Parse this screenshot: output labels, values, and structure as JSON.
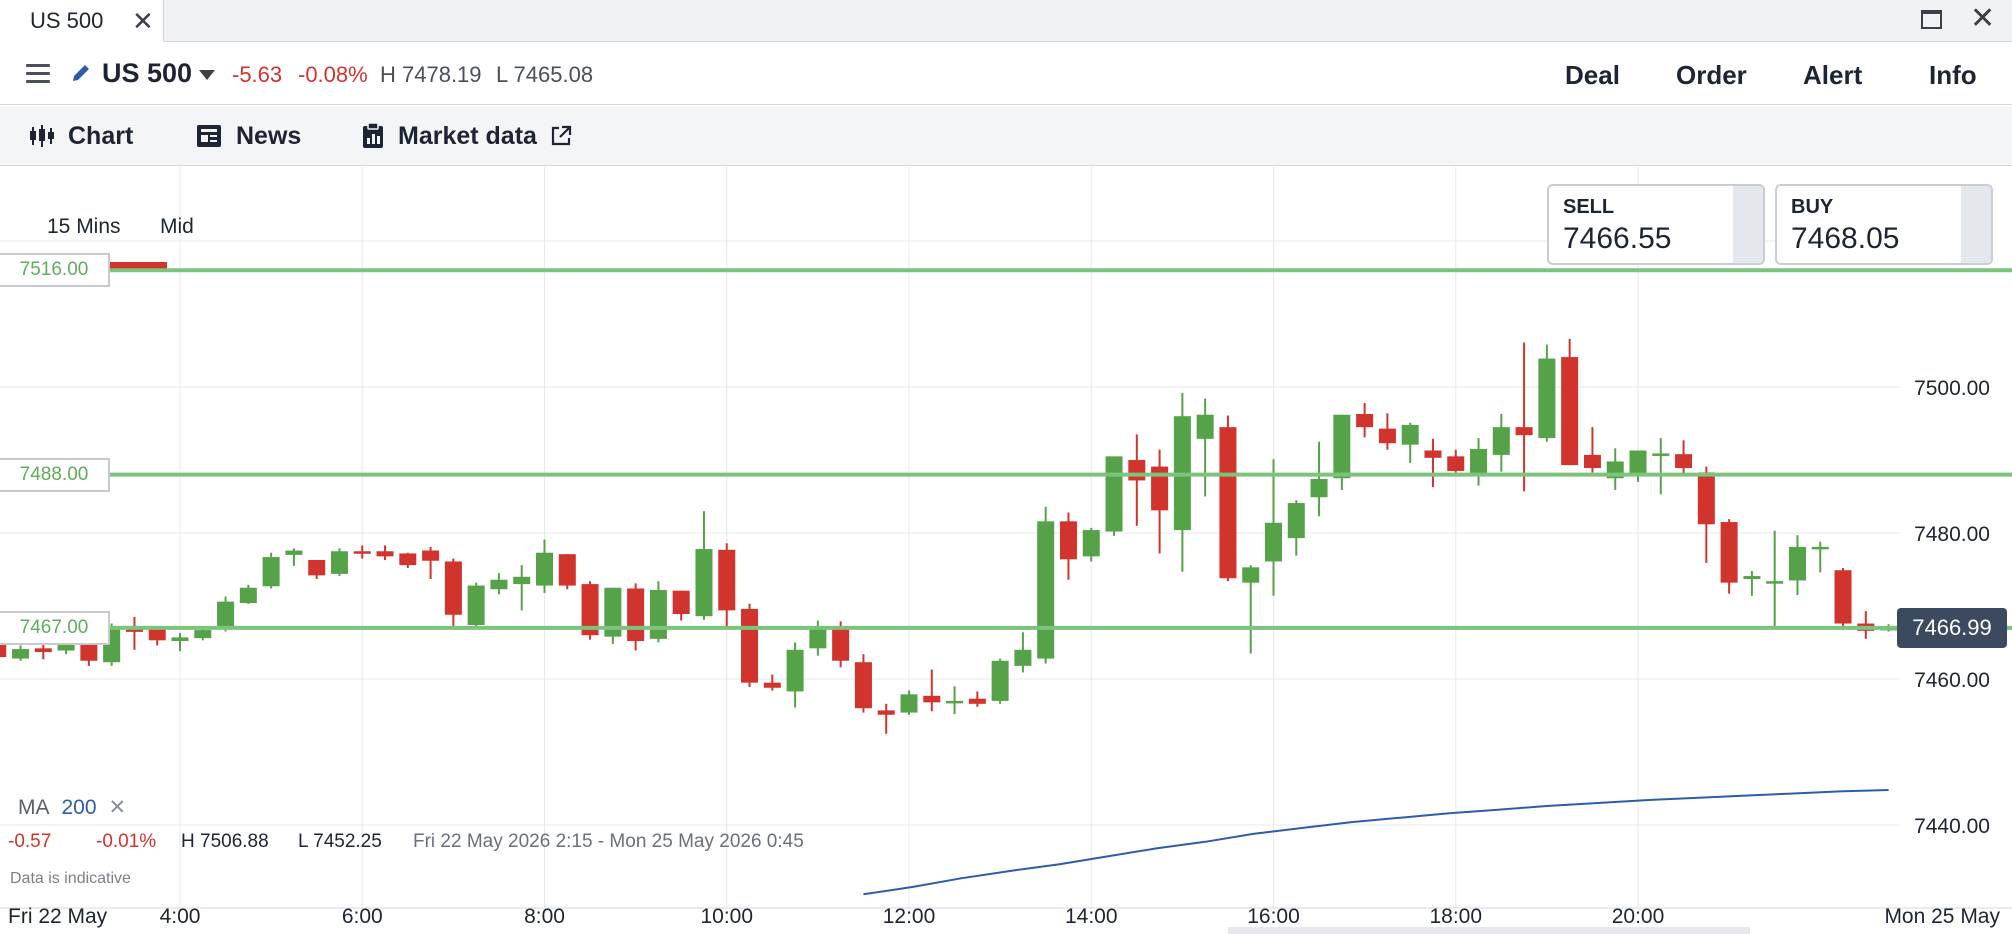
{
  "window": {
    "tab_title": "US 500"
  },
  "header": {
    "instrument": "US 500",
    "change": "-5.63",
    "change_pct": "-0.08%",
    "high": "H 7478.19",
    "low": "L 7465.08",
    "actions": [
      "Deal",
      "Order",
      "Alert",
      "Info"
    ]
  },
  "tabs": [
    {
      "label": "Chart",
      "active": true,
      "icon": "candlestick-icon"
    },
    {
      "label": "News",
      "icon": "newspaper-icon"
    },
    {
      "label": "Market data",
      "icon": "clipboard-icon",
      "external": true
    }
  ],
  "chart_toolbar": {
    "timeframe": "15 Mins",
    "price_type": "Mid"
  },
  "quotes": {
    "sell_label": "SELL",
    "sell": "7466.55",
    "buy_label": "BUY",
    "buy": "7468.05"
  },
  "levels": [
    {
      "label": "7516.00",
      "value": 7516.0
    },
    {
      "label": "7488.00",
      "value": 7488.0
    },
    {
      "label": "7467.00",
      "value": 7467.0
    }
  ],
  "current_price": "7466.99",
  "indicator": {
    "label": "MA",
    "period": "200"
  },
  "stats": {
    "change": "-0.57",
    "change_pct": "-0.01%",
    "high": "H 7506.88",
    "low": "L 7452.25",
    "range": "Fri 22 May 2026 2:15 - Mon 25 May 2026 0:45"
  },
  "disclaimer": "Data is indicative",
  "colors": {
    "up": "#55a249",
    "down": "#d0342c",
    "level": "#7cc47c",
    "ma": "#2d5da7",
    "accent": "#d0342c"
  },
  "chart_data": {
    "type": "candlestick",
    "x_axis": {
      "start_label": "Fri 22 May",
      "end_label": "Mon 25 May",
      "ticks": [
        "4:00",
        "6:00",
        "8:00",
        "10:00",
        "12:00",
        "14:00",
        "16:00",
        "18:00",
        "20:00"
      ]
    },
    "y_axis": {
      "ticks": [
        7500,
        7480,
        7460,
        7440
      ],
      "tick_labels": [
        "7500.00",
        "7480.00",
        "7460.00",
        "7440.00"
      ],
      "grid": true
    },
    "interval": "15 Mins",
    "candles": [
      [
        7465.8,
        7466.8,
        7464.8,
        7465.3
      ],
      [
        7465.5,
        7466.5,
        7457.5,
        7463.0
      ],
      [
        7462.8,
        7464.6,
        7462.5,
        7464.1
      ],
      [
        7464.2,
        7464.9,
        7462.7,
        7463.7
      ],
      [
        7463.9,
        7466.3,
        7463.4,
        7465.4
      ],
      [
        7465.7,
        7466.8,
        7461.8,
        7462.5
      ],
      [
        7462.3,
        7467.6,
        7461.8,
        7467.0
      ],
      [
        7466.8,
        7468.5,
        7464.0,
        7466.5
      ],
      [
        7466.8,
        7467.2,
        7464.6,
        7465.3
      ],
      [
        7465.2,
        7466.3,
        7463.8,
        7465.7
      ],
      [
        7465.6,
        7467.2,
        7465.3,
        7466.7
      ],
      [
        7466.9,
        7471.3,
        7466.5,
        7470.6
      ],
      [
        7470.4,
        7472.9,
        7470.3,
        7472.5
      ],
      [
        7472.7,
        7477.3,
        7472.4,
        7476.7
      ],
      [
        7477.0,
        7477.9,
        7475.5,
        7477.6
      ],
      [
        7476.3,
        7476.3,
        7473.7,
        7474.2
      ],
      [
        7474.4,
        7477.9,
        7474.1,
        7477.5
      ],
      [
        7477.5,
        7478.3,
        7476.5,
        7477.3
      ],
      [
        7477.5,
        7478.3,
        7476.3,
        7476.8
      ],
      [
        7477.2,
        7477.3,
        7475.2,
        7475.6
      ],
      [
        7477.6,
        7478.1,
        7473.7,
        7476.2
      ],
      [
        7476.1,
        7476.5,
        7467.0,
        7468.8
      ],
      [
        7467.4,
        7473.2,
        7467.1,
        7472.8
      ],
      [
        7472.3,
        7474.5,
        7471.6,
        7473.6
      ],
      [
        7473.0,
        7475.6,
        7469.4,
        7474.0
      ],
      [
        7472.8,
        7479.1,
        7471.8,
        7477.3
      ],
      [
        7477.1,
        7477.1,
        7472.3,
        7472.8
      ],
      [
        7473.0,
        7473.4,
        7465.4,
        7466.0
      ],
      [
        7465.8,
        7467.7,
        7464.8,
        7472.5
      ],
      [
        7472.4,
        7473.1,
        7463.9,
        7465.2
      ],
      [
        7465.5,
        7473.4,
        7465.0,
        7472.2
      ],
      [
        7472.1,
        7472.1,
        7468.0,
        7468.9
      ],
      [
        7468.6,
        7483.0,
        7468.1,
        7477.8
      ],
      [
        7477.7,
        7478.6,
        7467.2,
        7469.4
      ],
      [
        7469.6,
        7470.3,
        7458.9,
        7459.5
      ],
      [
        7459.5,
        7460.6,
        7458.4,
        7458.8
      ],
      [
        7458.3,
        7465.0,
        7456.1,
        7464.0
      ],
      [
        7464.2,
        7468.0,
        7463.2,
        7467.0
      ],
      [
        7467.2,
        7467.9,
        7461.6,
        7462.5
      ],
      [
        7462.3,
        7463.4,
        7455.4,
        7456.0
      ],
      [
        7455.7,
        7456.6,
        7452.5,
        7455.1
      ],
      [
        7455.4,
        7458.4,
        7455.1,
        7457.9
      ],
      [
        7457.7,
        7461.3,
        7455.6,
        7456.8
      ],
      [
        7456.7,
        7459.0,
        7455.2,
        7457.0
      ],
      [
        7457.3,
        7458.3,
        7456.2,
        7456.6
      ],
      [
        7457.0,
        7462.8,
        7456.6,
        7462.5
      ],
      [
        7461.8,
        7466.4,
        7460.9,
        7464.0
      ],
      [
        7462.8,
        7483.6,
        7462.1,
        7481.6
      ],
      [
        7481.6,
        7482.8,
        7473.6,
        7476.4
      ],
      [
        7476.8,
        7480.7,
        7476.1,
        7480.4
      ],
      [
        7480.2,
        7490.4,
        7479.6,
        7490.5
      ],
      [
        7490.0,
        7493.5,
        7481.0,
        7487.2
      ],
      [
        7489.1,
        7491.4,
        7477.2,
        7483.1
      ],
      [
        7480.4,
        7499.2,
        7474.7,
        7496.0
      ],
      [
        7492.9,
        7498.4,
        7485.0,
        7496.2
      ],
      [
        7494.5,
        7496.1,
        7473.4,
        7473.8
      ],
      [
        7473.2,
        7475.6,
        7463.5,
        7475.3
      ],
      [
        7476.1,
        7490.1,
        7471.4,
        7481.4
      ],
      [
        7479.3,
        7484.5,
        7476.9,
        7484.1
      ],
      [
        7484.9,
        7492.5,
        7482.3,
        7487.4
      ],
      [
        7487.5,
        7490.4,
        7485.9,
        7496.2
      ],
      [
        7496.3,
        7497.8,
        7493.1,
        7494.5
      ],
      [
        7494.3,
        7496.4,
        7491.4,
        7492.3
      ],
      [
        7492.1,
        7495.1,
        7489.6,
        7494.8
      ],
      [
        7491.3,
        7492.9,
        7486.3,
        7490.3
      ],
      [
        7490.5,
        7491.4,
        7488.3,
        7488.5
      ],
      [
        7488.0,
        7493.0,
        7486.5,
        7491.5
      ],
      [
        7490.7,
        7496.3,
        7488.4,
        7494.5
      ],
      [
        7494.5,
        7506.1,
        7485.7,
        7493.4
      ],
      [
        7493.0,
        7505.8,
        7492.5,
        7503.9
      ],
      [
        7504.1,
        7506.6,
        7495.2,
        7489.3
      ],
      [
        7490.7,
        7494.5,
        7488.3,
        7488.9
      ],
      [
        7487.5,
        7491.6,
        7485.9,
        7489.8
      ],
      [
        7487.9,
        7489.5,
        7487.0,
        7491.3
      ],
      [
        7490.6,
        7493.0,
        7485.3,
        7490.9
      ],
      [
        7490.8,
        7492.7,
        7488.2,
        7488.9
      ],
      [
        7488.3,
        7489.1,
        7475.9,
        7481.2
      ],
      [
        7481.5,
        7481.9,
        7471.7,
        7473.2
      ],
      [
        7473.7,
        7474.8,
        7471.4,
        7474.1
      ],
      [
        7473.3,
        7480.3,
        7466.8,
        7473.4
      ],
      [
        7473.5,
        7479.7,
        7471.5,
        7478.1
      ],
      [
        7477.9,
        7478.8,
        7474.6,
        7478.1
      ],
      [
        7474.9,
        7475.2,
        7466.7,
        7467.6
      ],
      [
        7467.6,
        7469.3,
        7465.5,
        7466.6
      ],
      [
        7467.0,
        7467.5,
        7466.5,
        7467.0
      ]
    ],
    "ma_series": {
      "name": "MA 200",
      "x_range": [
        "11:30",
        "22:45"
      ],
      "values": [
        7430.5,
        7431.5,
        7432.7,
        7433.7,
        7434.6,
        7435.7,
        7436.8,
        7437.7,
        7438.8,
        7439.6,
        7440.4,
        7441.0,
        7441.6,
        7442.1,
        7442.6,
        7443.0,
        7443.4,
        7443.7,
        7444.0,
        7444.3,
        7444.6,
        7444.8
      ]
    },
    "levels": [
      7516.0,
      7488.0,
      7467.0
    ]
  }
}
